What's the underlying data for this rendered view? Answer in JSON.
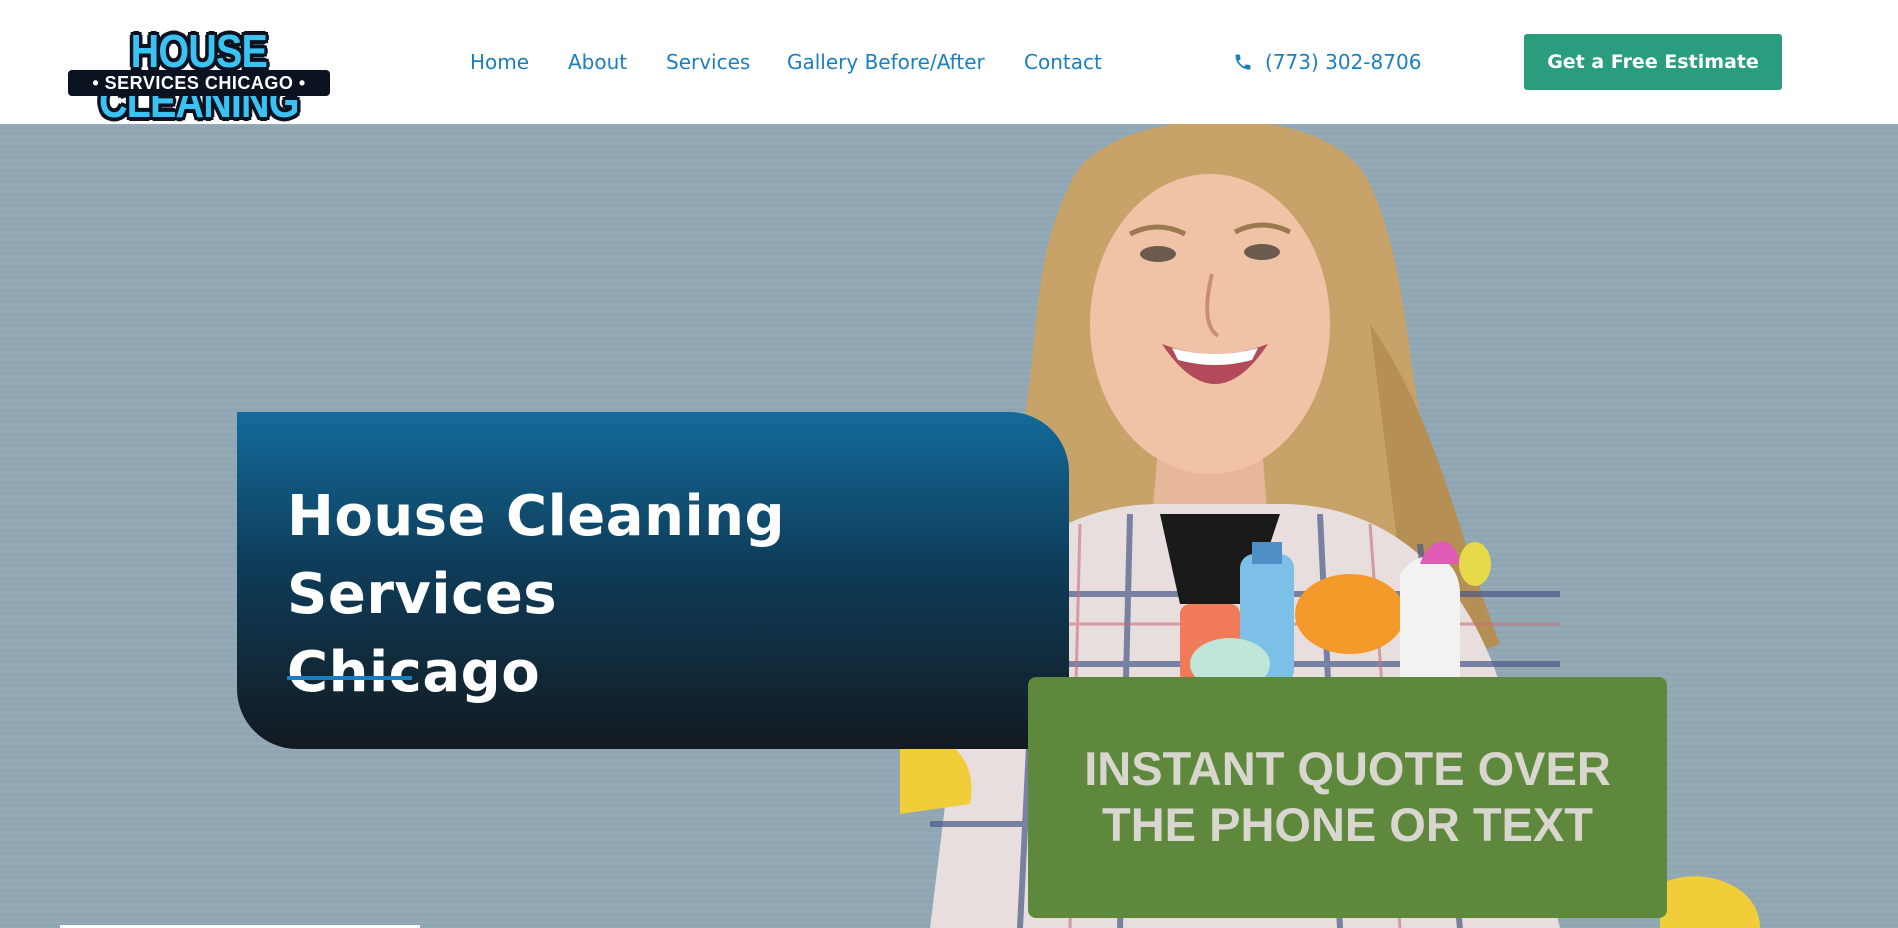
{
  "logo": {
    "line1": "HOUSE CLEANING",
    "line2": "• SERVICES CHICAGO •"
  },
  "nav": {
    "items": [
      {
        "label": "Home"
      },
      {
        "label": "About"
      },
      {
        "label": "Services"
      },
      {
        "label": "Gallery Before/After"
      },
      {
        "label": "Contact"
      }
    ]
  },
  "phone": {
    "icon": "phone-icon",
    "number": "(773) 302-8706"
  },
  "cta": {
    "label": "Get a Free Estimate"
  },
  "hero": {
    "title_line1": "House Cleaning Services",
    "title_line2": "Chicago",
    "quote_line1": "INSTANT QUOTE OVER",
    "quote_line2": "THE PHONE OR TEXT"
  },
  "colors": {
    "accent": "#1a7fc1",
    "cta": "#2a9d7e",
    "quote_bg": "#5e893c",
    "hero_bg": "#92a9b6"
  }
}
